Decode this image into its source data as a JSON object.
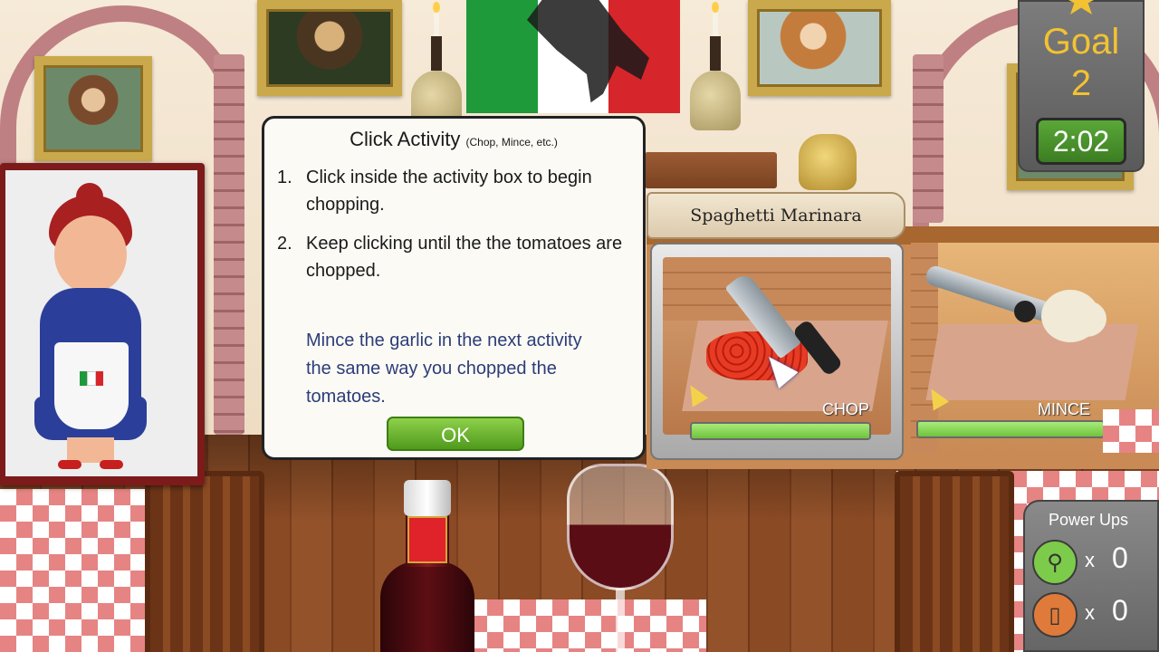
{
  "dialog": {
    "title": "Click Activity",
    "subtitle": "(Chop, Mince, etc.)",
    "steps": [
      {
        "num": "1.",
        "text": "Click inside the activity box to begin chopping."
      },
      {
        "num": "2.",
        "text": "Keep clicking until the the tomatoes are chopped."
      }
    ],
    "note": "Mince the garlic in the next activity the same way you chopped the tomatoes.",
    "ok_label": "OK"
  },
  "recipe": {
    "name": "Spaghetti Marinara"
  },
  "activities": [
    {
      "label": "CHOP",
      "progress": 1.0,
      "selected": true
    },
    {
      "label": "MINCE",
      "progress": 1.0,
      "selected": false
    }
  ],
  "goal": {
    "label": "Goal",
    "value": "2",
    "timer": "2:02"
  },
  "powerups": {
    "title": "Power Ups",
    "items": [
      {
        "icon": "whisk-icon",
        "x": "x",
        "count": "0",
        "color": "#7dcb4a"
      },
      {
        "icon": "jar-icon",
        "x": "x",
        "count": "0",
        "color": "#e07a3a"
      }
    ]
  },
  "colors": {
    "flag_green": "#1f9a3a",
    "flag_white": "#ffffff",
    "flag_red": "#d7262b"
  }
}
